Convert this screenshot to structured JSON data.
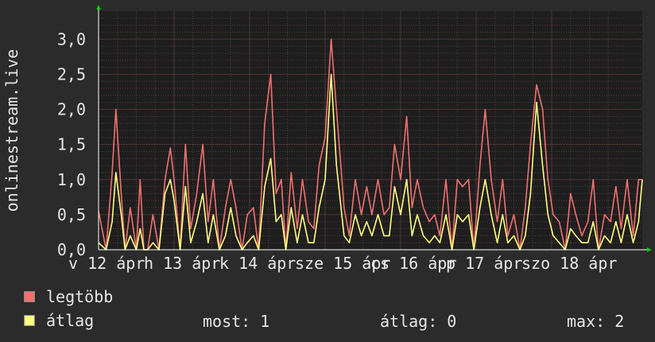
{
  "chart_data": {
    "type": "line",
    "ylabel": "onlinestream.live",
    "ylim": [
      0,
      3.4
    ],
    "grid": true,
    "y_ticks": [
      {
        "value": 0.0,
        "label": "0,0"
      },
      {
        "value": 0.5,
        "label": "0,5"
      },
      {
        "value": 1.0,
        "label": "1,0"
      },
      {
        "value": 1.5,
        "label": "1,5"
      },
      {
        "value": 2.0,
        "label": "2,0"
      },
      {
        "value": 2.5,
        "label": "2,5"
      },
      {
        "value": 3.0,
        "label": "3,0"
      }
    ],
    "x_range": [
      0,
      7.2
    ],
    "x_ticks": [
      {
        "value": 0.0,
        "label": "v 12 ápr"
      },
      {
        "value": 1.0,
        "label": "h 13 ápr"
      },
      {
        "value": 2.0,
        "label": "k 14 ápr"
      },
      {
        "value": 3.0,
        "label": "sze 15 ápr"
      },
      {
        "value": 4.0,
        "label": "cs 16 ápr"
      },
      {
        "value": 5.0,
        "label": "p 17 ápr"
      },
      {
        "value": 6.0,
        "label": "szo 18 ápr"
      }
    ],
    "series": [
      {
        "name": "legtöbb",
        "color": "#f07070",
        "x": [
          0.0,
          0.1,
          0.18,
          0.23,
          0.3,
          0.35,
          0.42,
          0.5,
          0.55,
          0.6,
          0.65,
          0.72,
          0.8,
          0.88,
          0.95,
          1.0,
          1.08,
          1.15,
          1.22,
          1.3,
          1.38,
          1.45,
          1.52,
          1.6,
          1.68,
          1.75,
          1.82,
          1.9,
          1.97,
          2.05,
          2.12,
          2.2,
          2.28,
          2.35,
          2.42,
          2.48,
          2.55,
          2.63,
          2.7,
          2.78,
          2.85,
          2.92,
          3.0,
          3.08,
          3.15,
          3.25,
          3.32,
          3.4,
          3.48,
          3.55,
          3.62,
          3.7,
          3.78,
          3.85,
          3.92,
          4.0,
          4.08,
          4.15,
          4.22,
          4.3,
          4.38,
          4.45,
          4.52,
          4.6,
          4.68,
          4.75,
          4.82,
          4.9,
          4.97,
          5.05,
          5.12,
          5.2,
          5.28,
          5.35,
          5.42,
          5.5,
          5.58,
          5.65,
          5.72,
          5.8,
          5.88,
          5.95,
          6.02,
          6.1,
          6.18,
          6.25,
          6.32,
          6.4,
          6.48,
          6.55,
          6.62,
          6.7,
          6.78,
          6.85,
          6.92,
          7.0,
          7.08,
          7.15,
          7.2
        ],
        "values": [
          0.55,
          0.0,
          1.1,
          2.0,
          0.8,
          0.0,
          0.6,
          0.0,
          1.0,
          0.0,
          0.0,
          0.5,
          0.0,
          1.0,
          1.45,
          1.0,
          0.0,
          1.5,
          0.3,
          0.8,
          1.5,
          0.4,
          1.0,
          0.0,
          0.6,
          1.0,
          0.6,
          0.0,
          0.5,
          0.6,
          0.0,
          1.8,
          2.5,
          0.8,
          1.0,
          0.0,
          1.1,
          0.3,
          1.0,
          0.4,
          0.3,
          1.2,
          1.6,
          3.0,
          2.0,
          0.6,
          0.2,
          1.0,
          0.5,
          0.9,
          0.5,
          1.0,
          0.5,
          0.6,
          1.5,
          1.0,
          1.9,
          0.6,
          1.0,
          0.6,
          0.4,
          0.5,
          0.2,
          1.0,
          0.0,
          1.0,
          0.9,
          1.0,
          0.0,
          1.2,
          2.0,
          1.0,
          0.4,
          1.0,
          0.2,
          0.5,
          0.0,
          0.6,
          1.5,
          2.35,
          2.0,
          1.0,
          0.5,
          0.4,
          0.0,
          0.8,
          0.5,
          0.2,
          0.4,
          1.0,
          0.0,
          0.5,
          0.4,
          0.9,
          0.3,
          1.0,
          0.2,
          1.0,
          1.0
        ]
      },
      {
        "name": "átlag",
        "color": "#ffff80",
        "x": [
          0.0,
          0.1,
          0.18,
          0.23,
          0.3,
          0.35,
          0.42,
          0.5,
          0.55,
          0.6,
          0.65,
          0.72,
          0.8,
          0.88,
          0.95,
          1.0,
          1.08,
          1.15,
          1.22,
          1.3,
          1.38,
          1.45,
          1.52,
          1.6,
          1.68,
          1.75,
          1.82,
          1.9,
          1.97,
          2.05,
          2.12,
          2.2,
          2.28,
          2.35,
          2.42,
          2.48,
          2.55,
          2.63,
          2.7,
          2.78,
          2.85,
          2.92,
          3.0,
          3.08,
          3.15,
          3.25,
          3.32,
          3.4,
          3.48,
          3.55,
          3.62,
          3.7,
          3.78,
          3.85,
          3.92,
          4.0,
          4.08,
          4.15,
          4.22,
          4.3,
          4.38,
          4.45,
          4.52,
          4.6,
          4.68,
          4.75,
          4.82,
          4.9,
          4.97,
          5.05,
          5.12,
          5.2,
          5.28,
          5.35,
          5.42,
          5.5,
          5.58,
          5.65,
          5.72,
          5.8,
          5.88,
          5.95,
          6.02,
          6.1,
          6.18,
          6.25,
          6.32,
          6.4,
          6.48,
          6.55,
          6.62,
          6.7,
          6.78,
          6.85,
          6.92,
          7.0,
          7.08,
          7.15,
          7.2
        ],
        "values": [
          0.1,
          0.0,
          0.4,
          1.1,
          0.5,
          0.0,
          0.2,
          0.0,
          0.3,
          0.0,
          0.0,
          0.1,
          0.0,
          0.8,
          1.0,
          0.7,
          0.0,
          0.9,
          0.1,
          0.4,
          0.8,
          0.1,
          0.5,
          0.0,
          0.2,
          0.6,
          0.2,
          0.0,
          0.1,
          0.2,
          0.0,
          0.9,
          1.3,
          0.4,
          0.5,
          0.0,
          0.6,
          0.1,
          0.5,
          0.1,
          0.1,
          0.6,
          1.0,
          2.5,
          1.2,
          0.2,
          0.1,
          0.5,
          0.2,
          0.4,
          0.2,
          0.5,
          0.2,
          0.2,
          0.9,
          0.5,
          1.0,
          0.2,
          0.5,
          0.2,
          0.1,
          0.2,
          0.1,
          0.5,
          0.0,
          0.5,
          0.4,
          0.5,
          0.0,
          0.6,
          1.0,
          0.5,
          0.1,
          0.5,
          0.1,
          0.2,
          0.0,
          0.2,
          0.8,
          2.1,
          1.2,
          0.5,
          0.2,
          0.1,
          0.0,
          0.3,
          0.2,
          0.1,
          0.1,
          0.4,
          0.0,
          0.2,
          0.1,
          0.4,
          0.1,
          0.5,
          0.1,
          0.4,
          1.0
        ]
      }
    ]
  },
  "legend": {
    "items": [
      {
        "label": "legtöbb",
        "color": "#f07070"
      },
      {
        "label": "átlag",
        "color": "#ffff80"
      }
    ]
  },
  "stats": {
    "current": "most: 1",
    "average": "átlag: 0",
    "max": "max: 2"
  },
  "colors": {
    "background": "#2b2b2b",
    "plot_background": "#1e1e1e",
    "grid_minor": "#5a3a3a",
    "grid_major": "#7a4a4a",
    "axis": "#ffffff",
    "text": "#e6e6e6"
  }
}
